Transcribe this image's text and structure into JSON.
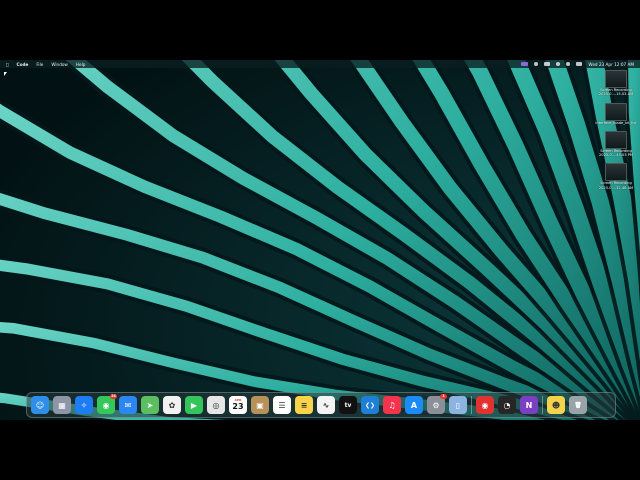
{
  "menubar": {
    "apple_icon": "apple-icon",
    "app_name": "Code",
    "menus": [
      "File",
      "Window",
      "Help"
    ],
    "clock": "Wed 23 Apr  12:07 AM"
  },
  "desktop_items": [
    {
      "label": "Screen Recording 2025-0....15.03 AM"
    },
    {
      "label": "interface_blade_kit_list"
    },
    {
      "label": "Screen Recording 2025-0....45.03 PM"
    },
    {
      "label": "Screen Recording 2025-0....32.48 AM"
    }
  ],
  "dock": {
    "calendar": {
      "month": "APR",
      "day": "23"
    },
    "apps": [
      {
        "id": "finder",
        "name": "Finder",
        "icon": "finder-icon",
        "color": "#2f8ee8",
        "glyph": "☺"
      },
      {
        "id": "launchpad",
        "name": "Launchpad",
        "icon": "launchpad-icon",
        "color": "#8d96a6",
        "glyph": "▦"
      },
      {
        "id": "safari",
        "name": "Safari",
        "icon": "safari-icon",
        "color": "#1e7cf2",
        "glyph": "✧"
      },
      {
        "id": "messages",
        "name": "Messages",
        "icon": "messages-icon",
        "color": "#35c759",
        "glyph": "◉",
        "badge": "24"
      },
      {
        "id": "mail",
        "name": "Mail",
        "icon": "mail-icon",
        "color": "#2a86f0",
        "glyph": "✉"
      },
      {
        "id": "maps",
        "name": "Maps",
        "icon": "maps-icon",
        "color": "#5bbf62",
        "glyph": "➤"
      },
      {
        "id": "photos",
        "name": "Photos",
        "icon": "photos-icon",
        "color": "#f2f2f2",
        "glyph": "✿"
      },
      {
        "id": "facetime",
        "name": "FaceTime",
        "icon": "facetime-icon",
        "color": "#33c45a",
        "glyph": "▶"
      },
      {
        "id": "chrome",
        "name": "Chrome",
        "icon": "chrome-icon",
        "color": "#e6e6e6",
        "glyph": "◎"
      },
      {
        "id": "calendar",
        "name": "Calendar",
        "icon": "calendar-icon",
        "color": "#ffffff",
        "glyph": ""
      },
      {
        "id": "keka",
        "name": "Archive Utility",
        "icon": "archive-icon",
        "color": "#b8905a",
        "glyph": "▣"
      },
      {
        "id": "reminders",
        "name": "Reminders",
        "icon": "reminders-icon",
        "color": "#ffffff",
        "glyph": "☰"
      },
      {
        "id": "notes",
        "name": "Notes",
        "icon": "notes-icon",
        "color": "#fbd44a",
        "glyph": "≡"
      },
      {
        "id": "freeform",
        "name": "Freeform",
        "icon": "freeform-icon",
        "color": "#f4f4f4",
        "glyph": "∿"
      },
      {
        "id": "appletv",
        "name": "Apple TV",
        "icon": "tv-icon",
        "color": "#111111",
        "glyph": "tv"
      },
      {
        "id": "vscode",
        "name": "VS Code",
        "icon": "vscode-icon",
        "color": "#1f7fd6",
        "glyph": "❮❯"
      },
      {
        "id": "music",
        "name": "Music",
        "icon": "music-icon",
        "color": "#f3344c",
        "glyph": "♫"
      },
      {
        "id": "appstore",
        "name": "App Store",
        "icon": "appstore-icon",
        "color": "#1b8cf5",
        "glyph": "A"
      },
      {
        "id": "settings",
        "name": "System Settings",
        "icon": "gear-icon",
        "color": "#8a8f98",
        "glyph": "⚙",
        "badge": "1"
      },
      {
        "id": "simulator",
        "name": "Simulator",
        "icon": "simulator-icon",
        "color": "#8cb4e0",
        "glyph": "▯"
      },
      {
        "id": "sep1",
        "separator": true
      },
      {
        "id": "screenrec",
        "name": "Screen Recorder",
        "icon": "record-icon",
        "color": "#e0322f",
        "glyph": "◉"
      },
      {
        "id": "activity",
        "name": "Activity Monitor",
        "icon": "activity-icon",
        "color": "#262626",
        "glyph": "◔"
      },
      {
        "id": "onenote",
        "name": "OneNote",
        "icon": "onenote-icon",
        "color": "#7b3fc1",
        "glyph": "N"
      },
      {
        "id": "sep2",
        "separator": true
      },
      {
        "id": "preview",
        "name": "Preview",
        "icon": "preview-icon",
        "color": "#f4d24a",
        "glyph": "☻"
      },
      {
        "id": "trash",
        "name": "Trash",
        "icon": "trash-icon",
        "color": "#9aa3a8",
        "glyph": "🗑"
      }
    ]
  }
}
